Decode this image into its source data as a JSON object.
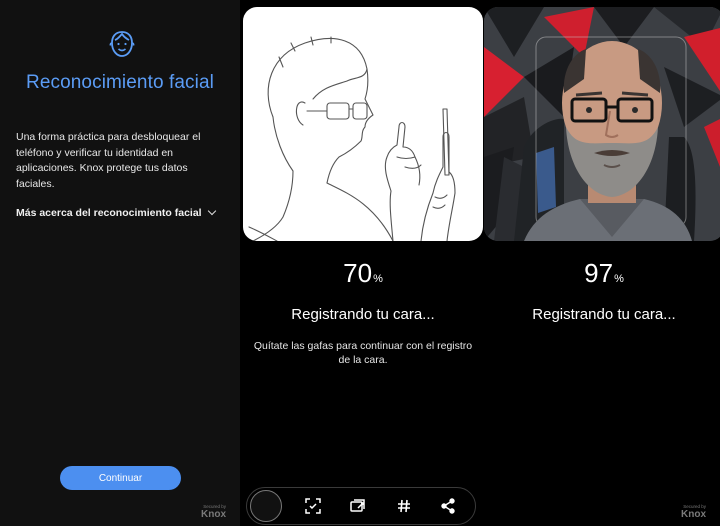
{
  "left_panel": {
    "title": "Reconocimiento facial",
    "description": "Una forma práctica para desbloquear el teléfono y verificar tu identidad en aplicaciones. Knox protege tus datos faciales.",
    "more_link": "Más acerca del reconocimiento facial",
    "continue_button": "Continuar",
    "secured_by": "Secured by",
    "knox": "Knox",
    "accent_color": "#5b9cf5",
    "button_color": "#4c8ff0"
  },
  "panel_left": {
    "percent": "70",
    "percent_symbol": "%",
    "status": "Registrando tu cara...",
    "hint": "Quítate las gafas para continuar con el registro de la cara."
  },
  "panel_right": {
    "percent": "97",
    "percent_symbol": "%",
    "status": "Registrando tu cara...",
    "secured_by": "Secured by",
    "knox": "Knox"
  },
  "toolbar": {
    "icons": [
      "screenshot-thumbnail",
      "scan-text-icon",
      "screen-record-icon",
      "hashtag-icon",
      "share-icon"
    ]
  }
}
